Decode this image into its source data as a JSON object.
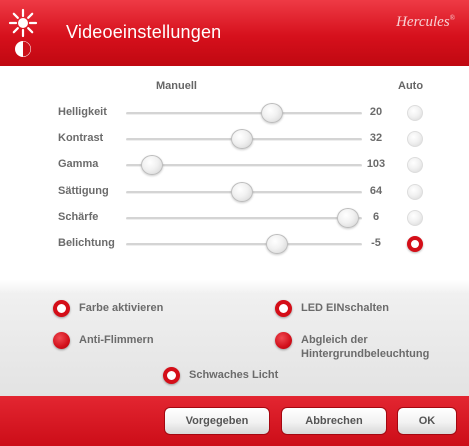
{
  "header": {
    "title": "Videoeinstellungen",
    "brand": "Hercules",
    "brand_mark": "®",
    "icon": "brightness-contrast-icon"
  },
  "columns": {
    "manual": "Manuell",
    "auto": "Auto"
  },
  "sliders": [
    {
      "label": "Helligkeit",
      "value": "20",
      "level": 0.62,
      "auto": false
    },
    {
      "label": "Kontrast",
      "value": "32",
      "level": 0.49,
      "auto": false
    },
    {
      "label": "Gamma",
      "value": "103",
      "level": 0.11,
      "auto": false
    },
    {
      "label": "Sättigung",
      "value": "64",
      "level": 0.49,
      "auto": false
    },
    {
      "label": "Schärfe",
      "value": "6",
      "level": 0.94,
      "auto": false
    },
    {
      "label": "Belichtung",
      "value": "-5",
      "level": 0.64,
      "auto": true
    }
  ],
  "options": [
    {
      "label": "Farbe aktivieren",
      "selected": true
    },
    {
      "label": "LED EINschalten",
      "selected": true
    },
    {
      "label": "Anti-Flimmern",
      "selected": false
    },
    {
      "label": "Abgleich der",
      "label2": "Hintergrundbeleuchtung",
      "selected": false
    },
    {
      "label": "Schwaches Licht",
      "selected": true
    }
  ],
  "footer": {
    "default_label": "Vorgegeben",
    "cancel_label": "Abbrechen",
    "ok_label": "OK"
  },
  "colors": {
    "accent": "#d40e18",
    "header": "#d6101c",
    "text": "#6b6b6b"
  }
}
